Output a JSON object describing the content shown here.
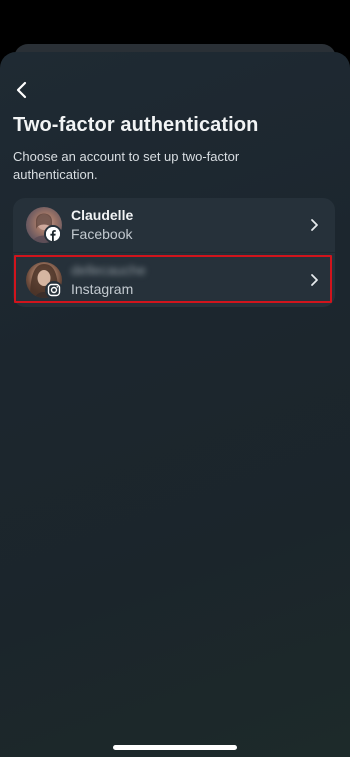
{
  "header": {
    "back_icon": "chevron-left-icon",
    "title": "Two-factor authentication",
    "subtitle": "Choose an account to set up two-factor authentication."
  },
  "accounts": [
    {
      "name": "Claudelle",
      "platform": "Facebook",
      "platform_icon": "facebook-icon",
      "chevron_icon": "chevron-right-icon"
    },
    {
      "name": "dellecauche",
      "name_blurred": true,
      "platform": "Instagram",
      "platform_icon": "instagram-icon",
      "chevron_icon": "chevron-right-icon",
      "highlighted": true
    }
  ],
  "colors": {
    "background": "#1f2a33",
    "card": "#26313a",
    "highlight": "#d1141c",
    "text_primary": "#f2f4f5",
    "text_secondary": "#c3cad0"
  }
}
